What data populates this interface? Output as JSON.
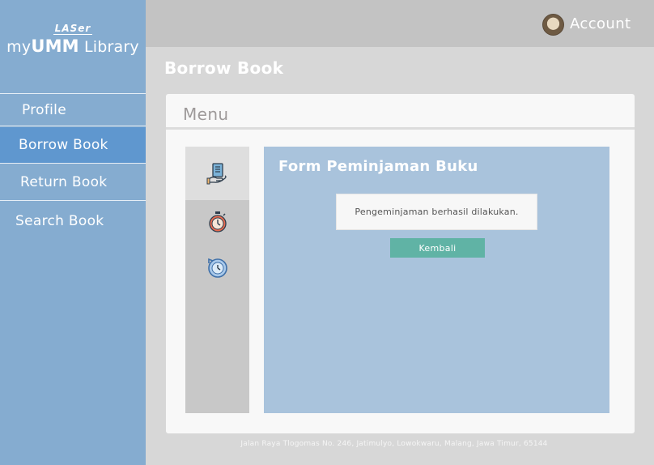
{
  "app": {
    "logo_top": "LASer",
    "logo_prefix": "my",
    "logo_bold": "UMM",
    "logo_suffix": " Library"
  },
  "sidebar": {
    "items": [
      {
        "label": "Profile"
      },
      {
        "label": "Borrow Book",
        "active": true
      },
      {
        "label": "Return Book"
      },
      {
        "label": "Search Book"
      }
    ]
  },
  "header": {
    "account_label": "Account",
    "avatar_icon": "user-avatar"
  },
  "page": {
    "title": "Borrow Book"
  },
  "card": {
    "title": "Menu",
    "icons": [
      "borrow-book-icon",
      "stopwatch-icon",
      "history-icon"
    ]
  },
  "form": {
    "title": "Form Peminjaman Buku",
    "message": "Pengeminjaman berhasil dilakukan.",
    "back_label": "Kembali"
  },
  "footer": {
    "address": "Jalan Raya Tlogomas No. 246, Jatimulyo, Lowokwaru, Malang, Jawa Timur, 65144"
  },
  "colors": {
    "sidebar": "#85acd0",
    "sidebar_active": "#5f97cf",
    "form_panel": "#a9c3dc",
    "button": "#60b3a5"
  }
}
